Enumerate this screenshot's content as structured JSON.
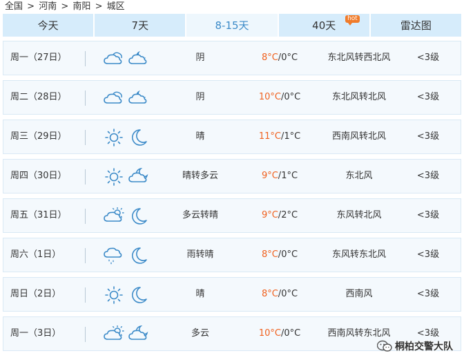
{
  "breadcrumb": {
    "items": [
      "全国",
      "河南",
      "南阳",
      "城区"
    ],
    "separator": ">"
  },
  "tabs": [
    {
      "label": "今天"
    },
    {
      "label": "7天"
    },
    {
      "label": "8-15天",
      "active": true
    },
    {
      "label": "40天",
      "badge": "hot"
    },
    {
      "label": "雷达图"
    }
  ],
  "forecast": [
    {
      "date": "周一（27日）",
      "day_icon": "cloudy-icon",
      "night_icon": "cloudy-moon-icon",
      "condition": "阴",
      "high": "8°C",
      "low": "0°C",
      "wind": "东北风转西北风",
      "level": "<3级"
    },
    {
      "date": "周二（28日）",
      "day_icon": "cloudy-icon",
      "night_icon": "cloudy-moon-icon",
      "condition": "阴",
      "high": "10°C",
      "low": "0°C",
      "wind": "东北风转北风",
      "level": "<3级"
    },
    {
      "date": "周三（29日）",
      "day_icon": "sun-icon",
      "night_icon": "moon-icon",
      "condition": "晴",
      "high": "11°C",
      "low": "1°C",
      "wind": "西南风转北风",
      "level": "<3级"
    },
    {
      "date": "周四（30日）",
      "day_icon": "sun-icon",
      "night_icon": "partly-cloudy-night-icon",
      "condition": "晴转多云",
      "high": "9°C",
      "low": "1°C",
      "wind": "东北风",
      "level": "<3级"
    },
    {
      "date": "周五（31日）",
      "day_icon": "partly-cloudy-day-icon",
      "night_icon": "moon-icon",
      "condition": "多云转晴",
      "high": "9°C",
      "low": "2°C",
      "wind": "东风转北风",
      "level": "<3级"
    },
    {
      "date": "周六（1日）",
      "day_icon": "rain-icon",
      "night_icon": "moon-icon",
      "condition": "雨转晴",
      "high": "8°C",
      "low": "0°C",
      "wind": "东风转东北风",
      "level": "<3级"
    },
    {
      "date": "周日（2日）",
      "day_icon": "sun-icon",
      "night_icon": "moon-icon",
      "condition": "晴",
      "high": "8°C",
      "low": "0°C",
      "wind": "西南风",
      "level": "<3级"
    },
    {
      "date": "周一（3日）",
      "day_icon": "partly-cloudy-day-icon",
      "night_icon": "partly-cloudy-night-icon",
      "condition": "多云",
      "high": "10°C",
      "low": "0°C",
      "wind": "西南风转东北风",
      "level": "<3级"
    }
  ],
  "colors": {
    "accent": "#3b8ac8",
    "tab_bg": "#d6ecfb",
    "row_bg": "#f4f9fd",
    "high_temp": "#f0601d",
    "hot_badge": "#f07b2a"
  },
  "watermark": {
    "text": "桐柏交警大队"
  }
}
